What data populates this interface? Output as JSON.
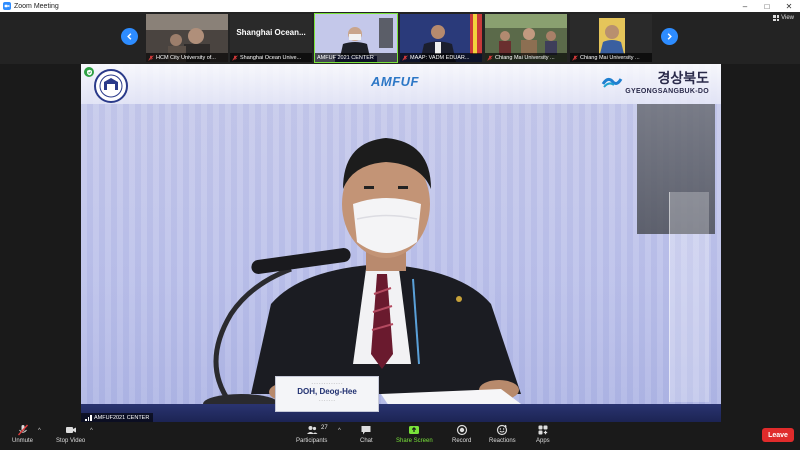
{
  "window": {
    "title": "Zoom Meeting",
    "controls": [
      "–",
      "□",
      "✕"
    ]
  },
  "strip": {
    "view_label": "View",
    "tiles": [
      {
        "caption": "HCM City University of...",
        "muted": true,
        "kind": "video"
      },
      {
        "caption": "Shanghai Ocean Unive...",
        "big_name": "Shanghai Ocean...",
        "muted": true,
        "kind": "text"
      },
      {
        "caption": "AMFUF 2021 CENTER",
        "muted": false,
        "kind": "video",
        "active": true
      },
      {
        "caption": "MAAP: VADM EDUAR...",
        "muted": true,
        "kind": "video"
      },
      {
        "caption": "Chiang Mai University ...",
        "muted": true,
        "kind": "video"
      },
      {
        "caption": "Chiang Mai University ...",
        "muted": true,
        "kind": "video"
      }
    ]
  },
  "main_video": {
    "caption": "AMFUF2021 CENTER",
    "logo_center": "AMFUF",
    "logo_right_kr": "경상북도",
    "logo_right_en": "GYEONGSANGBUK-DO",
    "nameplate_name": "DOH, Deog-Hee"
  },
  "toolbar": {
    "unmute": "Unmute",
    "stop_video": "Stop Video",
    "participants": "Participants",
    "participants_count": "27",
    "chat": "Chat",
    "share_screen": "Share Screen",
    "record": "Record",
    "reactions": "Reactions",
    "apps": "Apps",
    "leave": "Leave",
    "caret": "^"
  },
  "colors": {
    "accent": "#2d8cff",
    "leave": "#e02b2b",
    "share": "#79e33a",
    "active_tile": "#79e33a"
  }
}
